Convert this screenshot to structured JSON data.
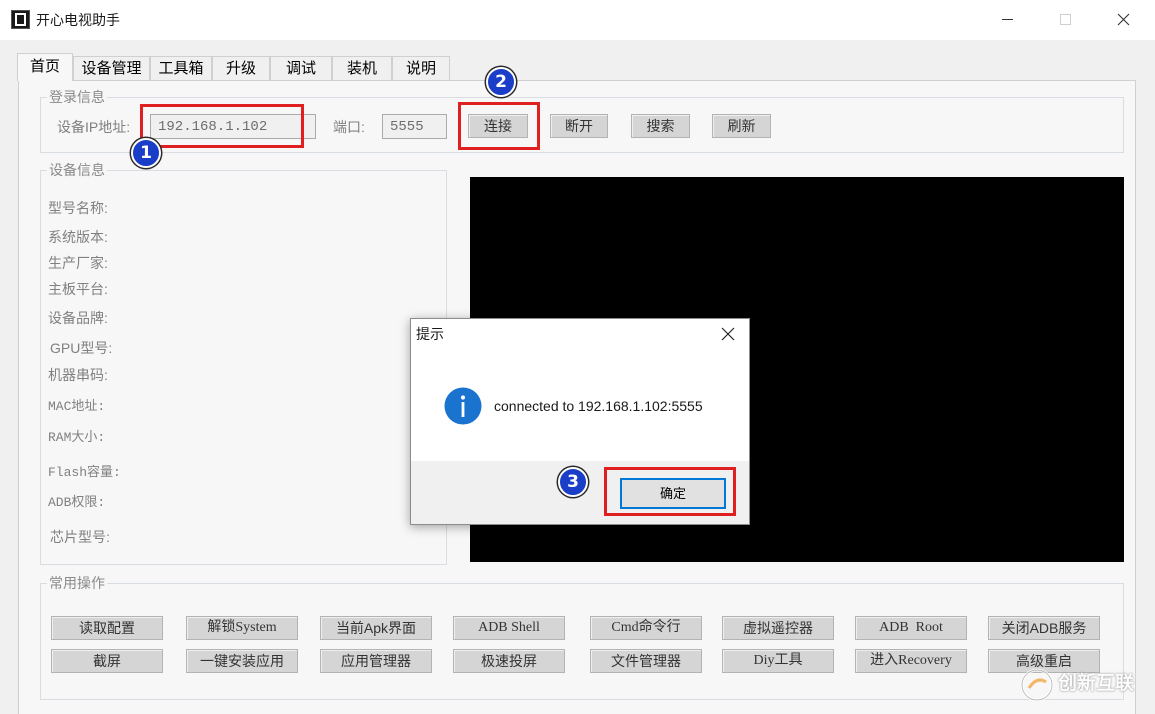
{
  "window": {
    "title": "开心电视助手",
    "icons": {
      "app": "app-icon",
      "minimize": "minimize-icon",
      "maximize": "maximize-icon",
      "close": "close-icon"
    }
  },
  "tabs": [
    {
      "label": "首页",
      "selected": true
    },
    {
      "label": "设备管理",
      "selected": false
    },
    {
      "label": "工具箱",
      "selected": false
    },
    {
      "label": "升级",
      "selected": false
    },
    {
      "label": "调试",
      "selected": false
    },
    {
      "label": "装机",
      "selected": false
    },
    {
      "label": "说明",
      "selected": false
    }
  ],
  "login": {
    "group_label": "登录信息",
    "ip_label": "设备IP地址:",
    "ip_value": "192.168.1.102",
    "port_label": "端口:",
    "port_value": "5555",
    "buttons": {
      "connect": "连接",
      "disconnect": "断开",
      "search": "搜索",
      "refresh": "刷新"
    }
  },
  "device_info": {
    "group_label": "设备信息",
    "fields": [
      "型号名称:",
      "系统版本:",
      "生产厂家:",
      "主板平台:",
      "设备品牌:",
      "GPU型号:",
      "机器串码:",
      "MAC地址:",
      "RAM大小:",
      "Flash容量:",
      "ADB权限:",
      "芯片型号:"
    ]
  },
  "common_ops": {
    "group_label": "常用操作",
    "row1": [
      "读取配置",
      "解锁System",
      "当前Apk界面",
      "ADB Shell",
      "Cmd命令行",
      "虚拟遥控器",
      "ADB  Root",
      "关闭ADB服务"
    ],
    "row2": [
      "截屏",
      "一键安装应用",
      "应用管理器",
      "极速投屏",
      "文件管理器",
      "Diy工具",
      "进入Recovery",
      "高级重启"
    ]
  },
  "dialog": {
    "title": "提示",
    "message": "connected to 192.168.1.102:5555",
    "ok_label": "确定",
    "icon": "info-icon",
    "close_icon": "close-icon"
  },
  "annotations": {
    "markers": [
      "1",
      "2",
      "3"
    ],
    "highlight_color": "#e02020",
    "marker_color": "#1b3ec9"
  },
  "watermark": "创新互联",
  "colors": {
    "window_bg": "#f0f0f0",
    "focus_blue": "#0078d7",
    "info_blue": "#1b73d0",
    "preview_bg": "#000000"
  }
}
